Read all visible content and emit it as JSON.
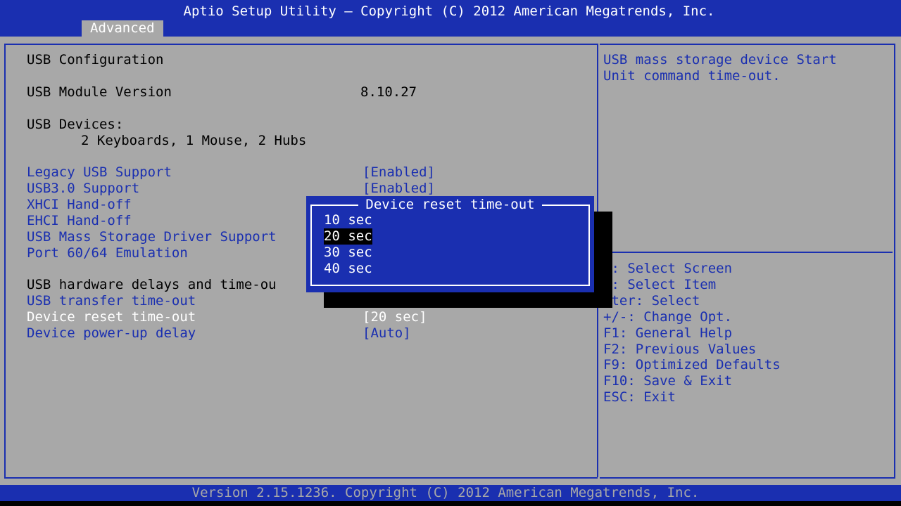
{
  "header": {
    "title": "Aptio Setup Utility – Copyright (C) 2012 American Megatrends, Inc.",
    "active_tab": "Advanced"
  },
  "main": {
    "section_title": "USB Configuration",
    "module_version_label": "USB Module Version",
    "module_version_value": "8.10.27",
    "devices_label": "USB Devices:",
    "devices_value": "2 Keyboards, 1 Mouse, 2 Hubs",
    "settings": [
      {
        "label": "Legacy USB Support",
        "value": "[Enabled]"
      },
      {
        "label": "USB3.0 Support",
        "value": "[Enabled]"
      },
      {
        "label": "XHCI Hand-off",
        "value": ""
      },
      {
        "label": "EHCI Hand-off",
        "value": ""
      },
      {
        "label": "USB Mass Storage Driver Support",
        "value": ""
      },
      {
        "label": "Port 60/64 Emulation",
        "value": ""
      }
    ],
    "delays_heading": "USB hardware delays and time-ou",
    "delay_settings": [
      {
        "label": "USB transfer time-out",
        "value": "",
        "selected": false
      },
      {
        "label": "Device reset time-out",
        "value": "[20 sec]",
        "selected": true
      },
      {
        "label": "Device power-up delay",
        "value": "[Auto]",
        "selected": false
      }
    ]
  },
  "help": {
    "line1": "USB mass storage device Start",
    "line2": "Unit command time-out."
  },
  "keys": [
    "←: Select Screen",
    "↓: Select Item",
    "nter: Select",
    "+/-: Change Opt.",
    "F1: General Help",
    "F2: Previous Values",
    "F9: Optimized Defaults",
    "F10: Save & Exit",
    "ESC: Exit"
  ],
  "dialog": {
    "title": "Device reset time-out",
    "options": [
      "10 sec",
      "20 sec",
      "30 sec",
      "40 sec"
    ],
    "selected_option": "20 sec"
  },
  "footer": {
    "text": "Version 2.15.1236. Copyright (C) 2012 American Megatrends, Inc."
  },
  "colors": {
    "background": "#a8a8a8",
    "accent_blue": "#1a2fb0",
    "text_white": "#ffffff",
    "text_black": "#000000"
  }
}
